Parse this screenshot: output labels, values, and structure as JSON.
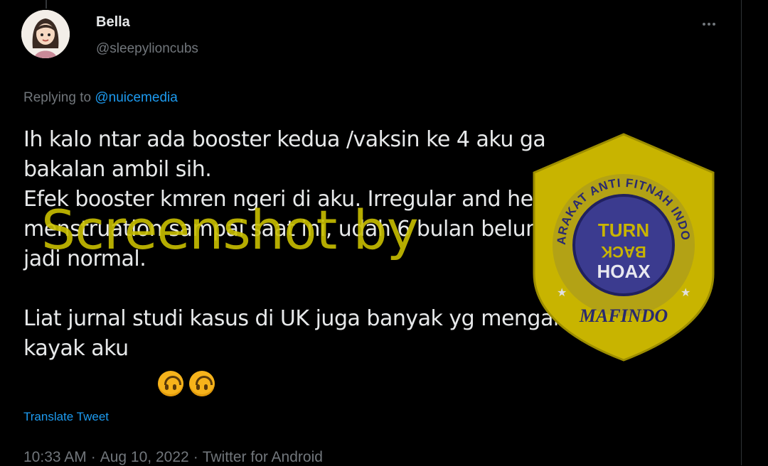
{
  "tweet": {
    "author": {
      "name": "Bella",
      "handle": "@sleepylioncubs"
    },
    "menu_icon": "more-horizontal-icon",
    "replying_prefix": "Replying to ",
    "replying_to": "@nuicemedia",
    "text": "Ih kalo ntar ada booster kedua /vaksin ke 4 aku ga\nbakalan ambil sih.\nEfek booster kmren ngeri di aku. Irregular and heavy\nmenstruation sampai saat ini, udah 6 bulan belum balik\njadi normal.\n\nLiat jurnal studi kasus di UK juga banyak yg mengalami\nkayak aku ",
    "emojis": [
      "upside-down-face-icon",
      "upside-down-face-icon"
    ],
    "translate_label": "Translate Tweet",
    "time": "10:33 AM",
    "date": "Aug 10, 2022",
    "source": "Twitter for Android"
  },
  "watermark": {
    "text": "Screenshot by",
    "badge": {
      "arc_text": "MASYARAKAT ANTI FITNAH INDONESIA",
      "line1": "TURN",
      "line2": "BACK",
      "line3": "HOAX",
      "org": "MAFINDO"
    }
  },
  "colors": {
    "background": "#000000",
    "text": "#e7e9ea",
    "muted": "#71767b",
    "link": "#1d9bf0",
    "watermark": "#c9bf00",
    "badge_blue": "#3b3b8f",
    "badge_gold": "#c8b400"
  }
}
